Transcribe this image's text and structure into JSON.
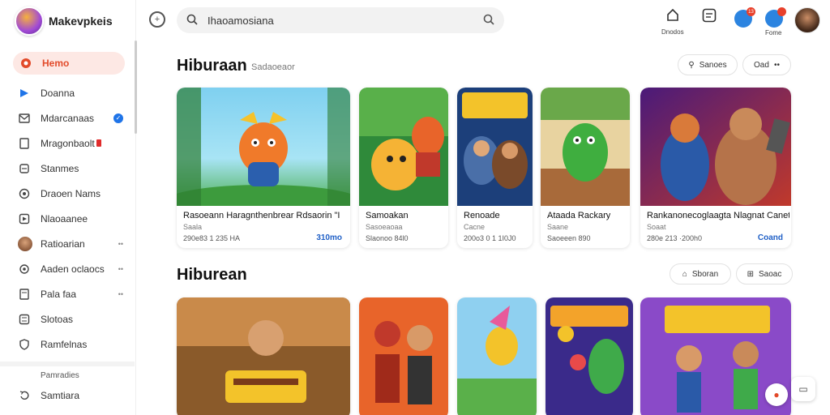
{
  "brand": {
    "name": "Makevpkeis"
  },
  "sidebar": {
    "items": [
      {
        "label": "Hemo",
        "icon": "home-icon"
      },
      {
        "label": "Doanna",
        "icon": "flag-icon"
      },
      {
        "label": "Mdarcanaas",
        "icon": "mail-icon"
      },
      {
        "label": "Mragonbaolt",
        "icon": "document-icon"
      },
      {
        "label": "Stanmes",
        "icon": "stack-icon"
      },
      {
        "label": "Draoen Nams",
        "icon": "compass-icon"
      },
      {
        "label": "Nlaoaanee",
        "icon": "play-icon"
      },
      {
        "label": "Ratioarian",
        "icon": "avatar-icon"
      },
      {
        "label": "Aaden oclaocs",
        "icon": "settings-icon"
      },
      {
        "label": "Pala faa",
        "icon": "tag-icon"
      },
      {
        "label": "Slotoas",
        "icon": "list-icon"
      },
      {
        "label": "Ramfelnas",
        "icon": "shield-icon"
      }
    ],
    "footer_label": "Pamradies",
    "footer_item": "Samtiara"
  },
  "search": {
    "value": "Ihaoamosiana"
  },
  "topbar": {
    "icon1_label": "Dnodos",
    "icon4_label": "Fome",
    "badge1": "13"
  },
  "section1": {
    "title": "Hiburaan",
    "subtitle": "Sadaoeaor",
    "pill1": "Sanoes",
    "pill2": "Oad",
    "cards": [
      {
        "title": "Rasoeann Haragnthenbrear Rdsaorin \"I",
        "sub": "Saala",
        "meta": "290e83 1 235 HA",
        "link": "310mo"
      },
      {
        "title": "Samoakan",
        "sub": "Sasoeaoaa",
        "meta": "Slaonoo 84l0",
        "link": ""
      },
      {
        "title": "Renoade",
        "sub": "Cacne",
        "meta": "200o3 0 1 1I0J0",
        "link": ""
      },
      {
        "title": "Ataada Rackary",
        "sub": "Saane",
        "meta": "Saoeeen 890",
        "link": ""
      },
      {
        "title": "Rankanonecoglaagta Nlagnat Canet",
        "sub": "Soaat",
        "meta": "280e 213 ·200h0",
        "link": "Coand"
      }
    ]
  },
  "section2": {
    "title": "Hiburean",
    "pill1": "Sboran",
    "pill2": "Saoac"
  },
  "colors": {
    "accent": "#e24a2a",
    "link": "#1f5fc6",
    "active_bg": "#fde8e4"
  }
}
